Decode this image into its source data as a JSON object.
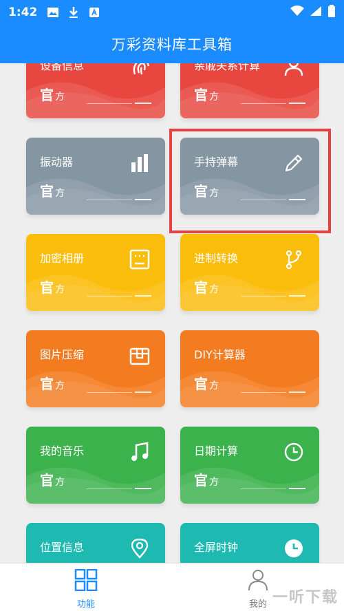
{
  "status_bar": {
    "time": "1:42"
  },
  "app_bar": {
    "title": "万彩资料库工具箱"
  },
  "badge": {
    "main": "官",
    "sub": "方"
  },
  "cards": [
    {
      "title": "设备信息",
      "color": "#e8473f",
      "icon": "fingerprint-icon"
    },
    {
      "title": "亲戚关系计算",
      "color": "#e8473f",
      "icon": "people-icon"
    },
    {
      "title": "振动器",
      "color": "#8596a3",
      "icon": "bar-chart-icon"
    },
    {
      "title": "手持弹幕",
      "color": "#8596a3",
      "icon": "pencil-icon"
    },
    {
      "title": "加密相册",
      "color": "#fbbd0c",
      "icon": "album-icon"
    },
    {
      "title": "进制转换",
      "color": "#fbbd0c",
      "icon": "branch-icon"
    },
    {
      "title": "图片压缩",
      "color": "#f47c20",
      "icon": "box-icon"
    },
    {
      "title": "DIY计算器",
      "color": "#f47c20",
      "icon": "calculator-icon"
    },
    {
      "title": "我的音乐",
      "color": "#3bb24c",
      "icon": "music-icon"
    },
    {
      "title": "日期计算",
      "color": "#3bb24c",
      "icon": "clock-icon"
    },
    {
      "title": "位置信息",
      "color": "#1ebab2",
      "icon": "location-icon"
    },
    {
      "title": "全屏时钟",
      "color": "#1ebab2",
      "icon": "clock-filled-icon"
    }
  ],
  "bottom_nav": {
    "items": [
      {
        "label": "功能",
        "active": true,
        "icon": "grid-icon"
      },
      {
        "label": "我的",
        "active": false,
        "icon": "user-icon"
      }
    ]
  },
  "watermark": "一听下载"
}
